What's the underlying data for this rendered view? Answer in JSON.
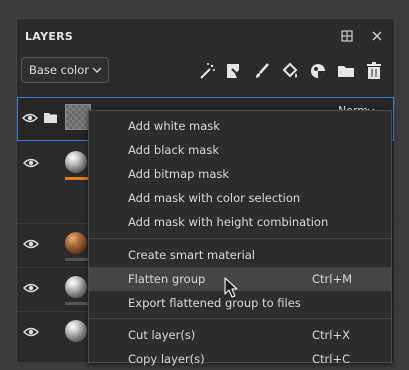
{
  "panel": {
    "title": "LAYERS",
    "icons": [
      "dock-icon",
      "close-icon"
    ]
  },
  "toolbar": {
    "blend_dropdown": "Base color",
    "tools": [
      "magic-wand-icon",
      "add-effect-icon",
      "brush-icon",
      "fill-icon",
      "smart-mask-icon",
      "folder-icon",
      "trash-icon"
    ]
  },
  "layers": [
    {
      "type": "group",
      "selected": true,
      "blend_mode": "Norm"
    },
    {
      "type": "layer",
      "material": "grey-sphere",
      "bar_color": "#e07b1e"
    },
    {
      "type": "layer",
      "material": "brown-sphere"
    },
    {
      "type": "layer",
      "material": "grey-sphere"
    },
    {
      "type": "layer",
      "material": "grey-sphere"
    }
  ],
  "context_menu": {
    "items": [
      {
        "label": "Add white mask",
        "shortcut": ""
      },
      {
        "label": "Add black mask",
        "shortcut": ""
      },
      {
        "label": "Add bitmap mask",
        "shortcut": ""
      },
      {
        "label": "Add mask with color selection",
        "shortcut": ""
      },
      {
        "label": "Add mask with height combination",
        "shortcut": ""
      },
      {
        "label": "Create smart material",
        "shortcut": ""
      },
      {
        "label": "Flatten group",
        "shortcut": "Ctrl+M",
        "highlighted": true
      },
      {
        "label": "Export flattened group to files",
        "shortcut": ""
      },
      {
        "label": "Cut layer(s)",
        "shortcut": "Ctrl+X"
      },
      {
        "label": "Copy layer(s)",
        "shortcut": "Ctrl+C"
      }
    ]
  },
  "colors": {
    "selection_border": "#3b7bd6",
    "menu_highlight": "#454545",
    "accent_bar": "#e07b1e"
  }
}
